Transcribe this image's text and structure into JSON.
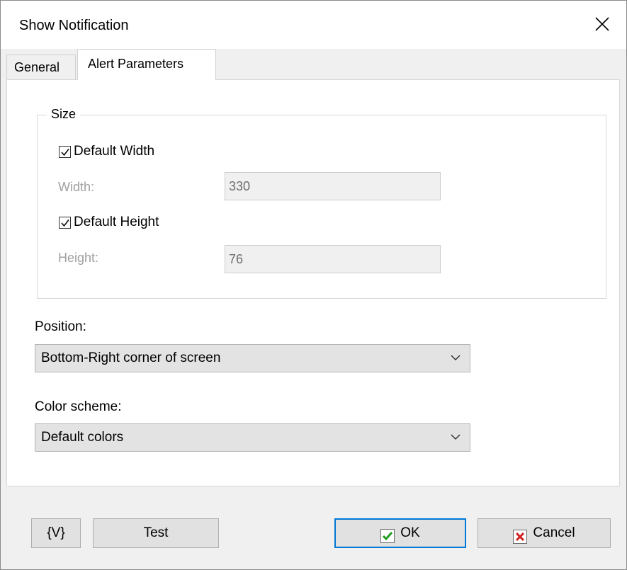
{
  "window": {
    "title": "Show Notification"
  },
  "tabs": [
    {
      "label": "General"
    },
    {
      "label": "Alert Parameters"
    }
  ],
  "size_group": {
    "legend": "Size",
    "default_width": {
      "label": "Default Width",
      "checked": true
    },
    "width": {
      "label": "Width:",
      "value": "330"
    },
    "default_height": {
      "label": "Default Height",
      "checked": true
    },
    "height": {
      "label": "Height:",
      "value": "76"
    }
  },
  "position": {
    "label": "Position:",
    "selected": "Bottom-Right corner of screen"
  },
  "color_scheme": {
    "label": "Color scheme:",
    "selected": "Default colors"
  },
  "buttons": {
    "variables": "{V}",
    "test": "Test",
    "ok": "OK",
    "cancel": "Cancel"
  },
  "colors": {
    "accent": "#0078d7",
    "ok_check": "#1f9a1f",
    "cancel_x": "#d02020"
  }
}
